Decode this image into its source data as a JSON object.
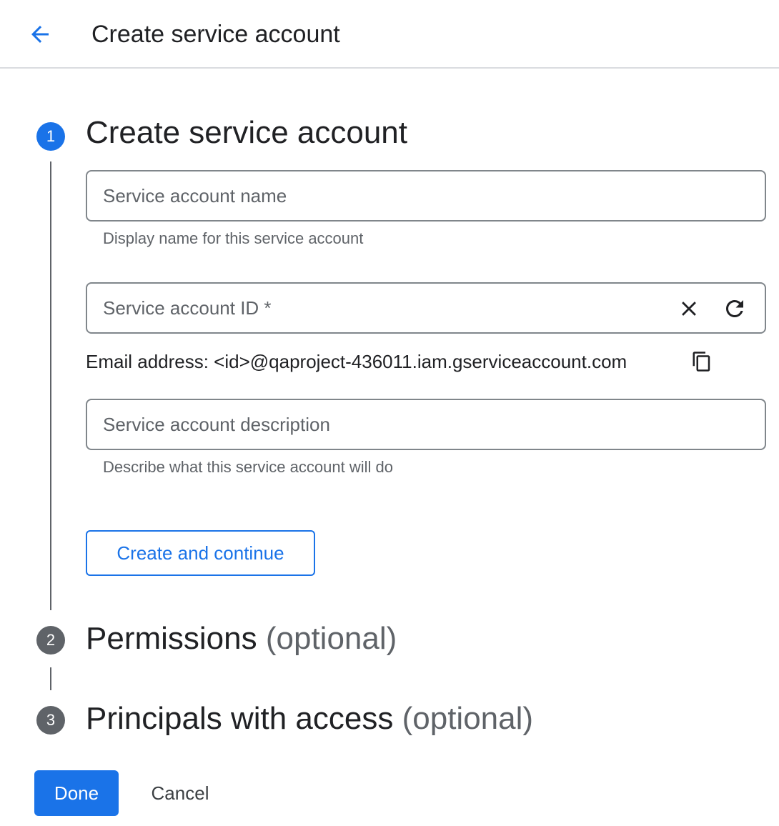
{
  "header": {
    "title": "Create service account",
    "back_icon": "arrow-back-icon"
  },
  "steps": [
    {
      "number": "1",
      "title": "Create service account",
      "optional": "",
      "state": "active"
    },
    {
      "number": "2",
      "title": "Permissions",
      "optional": "(optional)",
      "state": "inactive"
    },
    {
      "number": "3",
      "title": "Principals with access",
      "optional": "(optional)",
      "state": "inactive"
    }
  ],
  "form": {
    "name_field": {
      "placeholder": "Service account name",
      "value": "",
      "hint": "Display name for this service account"
    },
    "id_field": {
      "placeholder": "Service account ID *",
      "value": "",
      "clear_icon": "close-icon",
      "refresh_icon": "refresh-icon"
    },
    "email": {
      "text": "Email address: <id>@qaproject-436011.iam.gserviceaccount.com",
      "copy_icon": "copy-icon"
    },
    "description_field": {
      "placeholder": "Service account description",
      "value": "",
      "hint": "Describe what this service account will do"
    },
    "create_button": "Create and continue"
  },
  "footer": {
    "done_label": "Done",
    "cancel_label": "Cancel"
  },
  "colors": {
    "primary": "#1a73e8",
    "step_inactive": "#5f6368",
    "text": "#202124",
    "secondary_text": "#5f6368",
    "border": "#80868b"
  }
}
